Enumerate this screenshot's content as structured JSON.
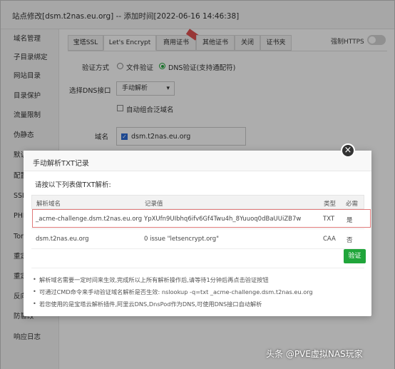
{
  "window": {
    "title": "站点修改[dsm.t2nas.eu.org] -- 添加时间[2022-06-16 14:46:38]"
  },
  "sidebar": {
    "items": [
      {
        "label": "域名管理"
      },
      {
        "label": "子目录绑定"
      },
      {
        "label": "网站目录"
      },
      {
        "label": "目录保护"
      },
      {
        "label": "流量限制"
      },
      {
        "label": "伪静态"
      },
      {
        "label": "默认"
      },
      {
        "label": "配置"
      },
      {
        "label": "SSL"
      },
      {
        "label": "PHP"
      },
      {
        "label": "Tom"
      },
      {
        "label": "重定"
      },
      {
        "label": "重定"
      },
      {
        "label": "反向"
      },
      {
        "label": "防篡改"
      },
      {
        "label": "响应日志"
      }
    ]
  },
  "tabs": [
    {
      "label": "宝塔SSL"
    },
    {
      "label": "Let's Encrypt"
    },
    {
      "label": "商用证书"
    },
    {
      "label": "其他证书"
    },
    {
      "label": "关闭"
    },
    {
      "label": "证书夹"
    }
  ],
  "force_https": {
    "label": "强制HTTPS",
    "enabled": false
  },
  "form": {
    "verify_label": "验证方式",
    "file_verify": "文件验证",
    "dns_verify": "DNS验证(支持通配符)",
    "dns_api_label": "选择DNS接口",
    "dns_api_value": "手动解析",
    "wildcard_label": "自动组合泛域名",
    "domain_label": "域名",
    "domain_value": "dsm.t2nas.eu.org"
  },
  "modal": {
    "title": "手动解析TXT记录",
    "intro": "请按以下列表做TXT解析:",
    "columns": [
      "解析域名",
      "记录值",
      "类型",
      "必需"
    ],
    "rows": [
      {
        "domain": "_acme-challenge.dsm.t2nas.eu.org",
        "value": "YpXUfn9UIbhq6ifv6Gf4Twu4h_8Yuuoq0dBaUUiZB7w",
        "type": "TXT",
        "required": "是"
      },
      {
        "domain": "dsm.t2nas.eu.org",
        "value": "0 issue \"letsencrypt.org\"",
        "type": "CAA",
        "required": "否"
      }
    ],
    "verify_button": "验证",
    "notes": [
      "解析域名需要一定时间来生效,完成所以上所有解析操作后,请等待1分钟后再点击验证按钮",
      "可通过CMD命令来手动验证域名解析是否生效: nslookup -q=txt _acme-challenge.dsm.t2nas.eu.org",
      "若您使用的是宝塔云解析插件,阿里云DNS,DnsPod作为DNS,可使用DNS接口自动解析"
    ]
  },
  "watermark": "头条 @PVE虚拟NAS玩家",
  "colors": {
    "accent": "#20a53a",
    "highlight": "#e07a7a",
    "checkbox": "#2b6bd6"
  }
}
